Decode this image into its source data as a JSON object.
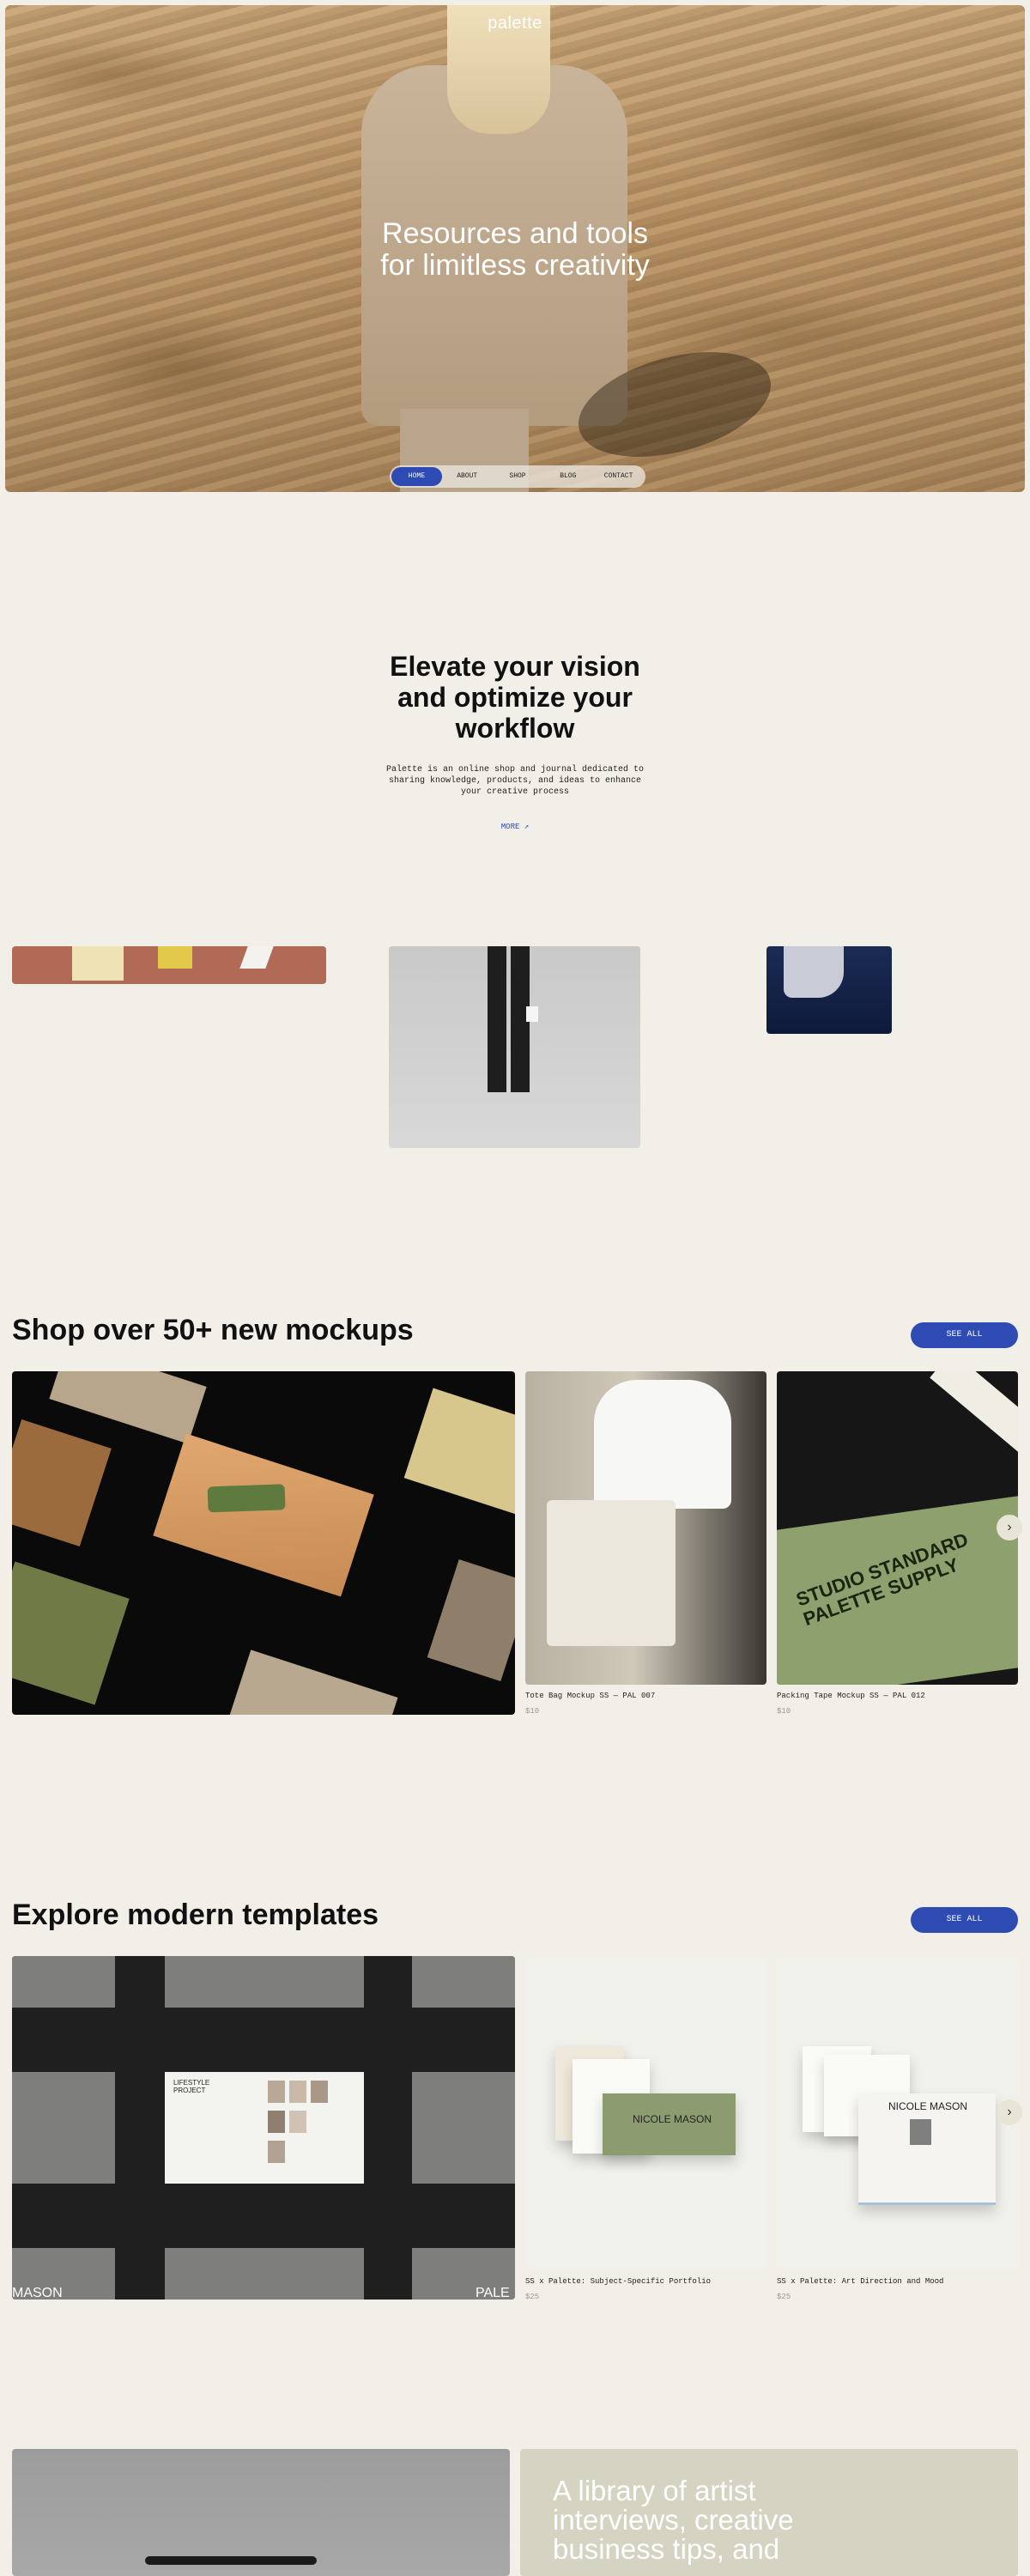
{
  "hero": {
    "logo": "palette",
    "title_line1": "Resources and tools",
    "title_line2": "for limitless creativity"
  },
  "nav": {
    "items": [
      "HOME",
      "ABOUT",
      "SHOP",
      "BLOG",
      "CONTACT"
    ],
    "active": "HOME"
  },
  "intro": {
    "title_line1": "Elevate your vision",
    "title_line2": "and optimize your",
    "title_line3": "workflow",
    "description": "Palette is an online shop and journal dedicated to sharing knowledge, products, and ideas to enhance your creative process",
    "more_label": "MORE ↗"
  },
  "mockups": {
    "title": "Shop over 50+ new mockups",
    "see_all": "SEE ALL",
    "items": [
      {
        "name": "Tote Bag Mockup SS — PAL 007",
        "price": "$10"
      },
      {
        "name": "Packing Tape Mockup SS — PAL 012",
        "price": "$10"
      }
    ],
    "tape_text": "STUDIO STANDARD PALETTE SUPPLY"
  },
  "templates": {
    "title": "Explore modern templates",
    "see_all": "SEE ALL",
    "items": [
      {
        "name": "SS x Palette: Subject-Specific Portfolio",
        "price": "$25"
      },
      {
        "name": "SS x Palette: Art Direction and Mood",
        "price": "$25"
      }
    ],
    "preview_left_label": "MASON",
    "preview_right_label": "PALE",
    "project_label": "LIFESTYLE PROJECT",
    "portfolio_name": "NICOLE MASON"
  },
  "journal": {
    "text": "A library of artist interviews, creative business tips, and"
  },
  "colors": {
    "accent": "#2e4bb4",
    "background": "#f2efe9"
  },
  "icons": {
    "arrow_next": "chevron-right-icon"
  }
}
